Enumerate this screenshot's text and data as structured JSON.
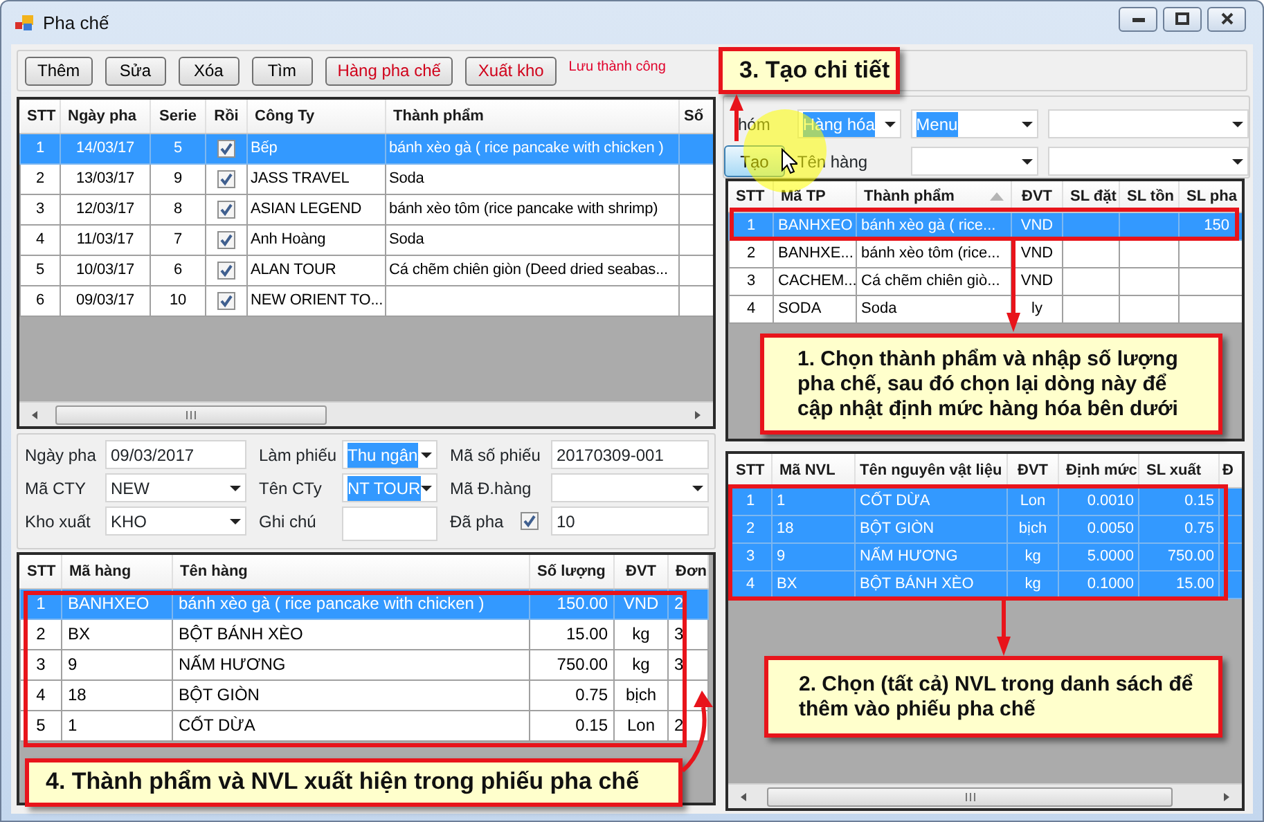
{
  "window": {
    "title": "Pha chế"
  },
  "toolbar": {
    "buttons": [
      {
        "label": "Thêm",
        "kind": "normal"
      },
      {
        "label": "Sửa",
        "kind": "normal"
      },
      {
        "label": "Xóa",
        "kind": "normal"
      },
      {
        "label": "Tìm",
        "kind": "normal"
      },
      {
        "label": "Hàng pha chế",
        "kind": "accent"
      },
      {
        "label": "Xuất kho",
        "kind": "accent"
      }
    ],
    "status": "Lưu thành công"
  },
  "orders_grid": {
    "columns": [
      "STT",
      "Ngày pha",
      "Serie",
      "Rồi",
      "Công Ty",
      "Thành phẩm",
      "Số"
    ],
    "rows": [
      {
        "stt": "1",
        "date": "14/03/17",
        "serie": "5",
        "done": true,
        "company": "Bếp",
        "product": "bánh xèo gà ( rice pancake with chicken )",
        "selected": true
      },
      {
        "stt": "2",
        "date": "13/03/17",
        "serie": "9",
        "done": true,
        "company": "JASS TRAVEL",
        "product": "Soda",
        "selected": false
      },
      {
        "stt": "3",
        "date": "12/03/17",
        "serie": "8",
        "done": true,
        "company": "ASIAN LEGEND",
        "product": "bánh xèo tôm (rice pancake with shrimp)",
        "selected": false
      },
      {
        "stt": "4",
        "date": "11/03/17",
        "serie": "7",
        "done": true,
        "company": "Anh Hoàng",
        "product": "Soda",
        "selected": false
      },
      {
        "stt": "5",
        "date": "10/03/17",
        "serie": "6",
        "done": true,
        "company": "ALAN TOUR",
        "product": "Cá chẽm chiên giòn (Deed dried seabas...",
        "selected": false
      },
      {
        "stt": "6",
        "date": "09/03/17",
        "serie": "10",
        "done": true,
        "company": "NEW ORIENT TO...",
        "selected": false
      }
    ]
  },
  "form": {
    "fields": [
      {
        "label": "Ngày pha",
        "kind": "text",
        "value": "09/03/2017",
        "text_selected": false
      },
      {
        "label": "Làm phiếu",
        "kind": "combo",
        "value": "Thu ngân",
        "text_selected": true
      },
      {
        "label": "Mã số phiếu",
        "kind": "text",
        "value": "20170309-001",
        "text_selected": false
      },
      {
        "label": "Mã CTY",
        "kind": "combo",
        "value": "NEW",
        "text_selected": false
      },
      {
        "label": "Tên CTy",
        "kind": "combo",
        "value": "NT TOUR",
        "text_selected": true
      },
      {
        "label": "Mã Đ.hàng",
        "kind": "combo"
      },
      {
        "label": "Kho xuất",
        "kind": "combo",
        "value": "KHO",
        "text_selected": false
      },
      {
        "label": "Ghi chú",
        "kind": "text"
      },
      {
        "label": "Đã pha",
        "kind": "check",
        "checked": true,
        "value": "10",
        "text_selected": false
      }
    ]
  },
  "receipt_grid": {
    "columns": [
      "STT",
      "Mã hàng",
      "Tên hàng",
      "Số lượng",
      "ĐVT",
      "Đơn"
    ],
    "rows": [
      {
        "stt": "1",
        "code": "BANHXEO",
        "name": "bánh xèo gà ( rice pancake with chicken )",
        "qty": "150.00",
        "unit": "VND",
        "price": "2",
        "selected": true
      },
      {
        "stt": "2",
        "code": "BX",
        "name": "BỘT BÁNH XÈO",
        "qty": "15.00",
        "unit": "kg",
        "price": "3",
        "selected": false
      },
      {
        "stt": "3",
        "code": "9",
        "name": "NẤM HƯƠNG",
        "qty": "750.00",
        "unit": "kg",
        "price": "3",
        "selected": false
      },
      {
        "stt": "4",
        "code": "18",
        "name": "BỘT GIÒN",
        "qty": "0.75",
        "unit": "bịch",
        "selected": false
      },
      {
        "stt": "5",
        "code": "1",
        "name": "CỐT DỪA",
        "qty": "0.15",
        "unit": "Lon",
        "price": "2",
        "selected": false
      }
    ]
  },
  "filters": {
    "group_label": "hóm",
    "group_combos": [
      {
        "kind": "combo",
        "value": "Hàng hóa",
        "text_selected": true
      },
      {
        "kind": "combo",
        "value": "Menu",
        "text_selected": true
      },
      {
        "kind": "combo"
      }
    ],
    "create_button": "Tạo",
    "name_label": "Tên hàng",
    "name_combos": [
      {
        "kind": "combo"
      },
      {
        "kind": "combo"
      }
    ]
  },
  "products_grid": {
    "columns": [
      {
        "label": "STT"
      },
      {
        "label": "Mã TP"
      },
      {
        "label": "Thành phẩm",
        "sorted": true
      },
      {
        "label": "ĐVT"
      },
      {
        "label": "SL đặt"
      },
      {
        "label": "SL tồn"
      },
      {
        "label": "SL pha"
      }
    ],
    "rows": [
      {
        "stt": "1",
        "code": "BANHXEO",
        "name": "bánh xèo gà ( rice...",
        "unit": "VND",
        "qty": "150",
        "selected": true
      },
      {
        "stt": "2",
        "code": "BANHXE...",
        "name": "bánh xèo tôm (rice...",
        "unit": "VND",
        "selected": false
      },
      {
        "stt": "3",
        "code": "CACHEM...",
        "name": "Cá chẽm chiên giò...",
        "unit": "VND",
        "selected": false
      },
      {
        "stt": "4",
        "code": "SODA",
        "name": "Soda",
        "unit": "ly",
        "selected": false
      }
    ]
  },
  "materials_grid": {
    "columns": [
      "STT",
      "Mã NVL",
      "Tên nguyên vật liệu",
      "ĐVT",
      "Định mức",
      "SL xuất",
      "Đ"
    ],
    "rows": [
      {
        "stt": "1",
        "code": "1",
        "name": "CỐT DỪA",
        "unit": "Lon",
        "norm": "0.0010",
        "qty": "0.15",
        "selected": true
      },
      {
        "stt": "2",
        "code": "18",
        "name": "BỘT GIÒN",
        "unit": "bịch",
        "norm": "0.0050",
        "qty": "0.75",
        "selected": true
      },
      {
        "stt": "3",
        "code": "9",
        "name": "NẤM HƯƠNG",
        "unit": "kg",
        "norm": "5.0000",
        "qty": "750.00",
        "selected": true
      },
      {
        "stt": "4",
        "code": "BX",
        "name": "BỘT BÁNH XÈO",
        "unit": "kg",
        "norm": "0.1000",
        "qty": "15.00",
        "selected": true
      }
    ]
  },
  "annotations": [
    {
      "kind": "create",
      "text": "3. Tạo chi tiết"
    },
    {
      "kind": "product",
      "text": "1. Chọn thành phẩm và nhập số lượng\npha chế, sau đó chọn lại dòng này để\ncập nhật định mức hàng hóa bên dưới"
    },
    {
      "kind": "materials",
      "text": "2. Chọn (tất cả) NVL trong danh sách để\nthêm vào phiếu pha chế"
    },
    {
      "kind": "receipt",
      "text": "4. Thành phẩm và NVL xuất hiện trong phiếu pha chế"
    }
  ]
}
